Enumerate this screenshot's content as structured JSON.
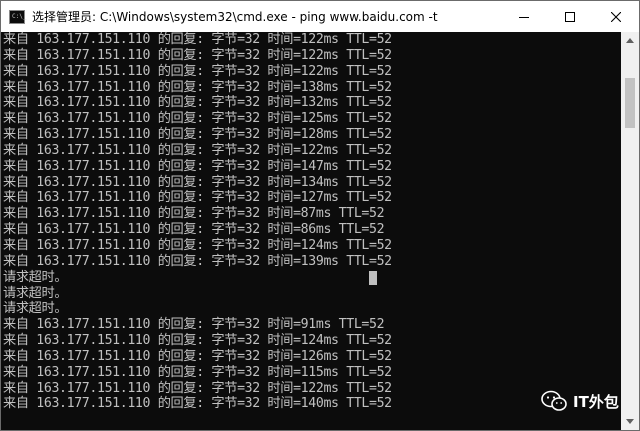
{
  "window": {
    "title": "选择管理员: C:\\Windows\\system32\\cmd.exe - ping  www.baidu.com -t",
    "icon": "cmd-icon",
    "icon_text": "C:\\_"
  },
  "controls": {
    "minimize": "minimize-icon",
    "maximize": "maximize-icon",
    "close": "close-icon"
  },
  "console": {
    "foreground": "#c0c0c0",
    "background": "#0c0c0c",
    "lines": [
      "来自 163.177.151.110 的回复: 字节=32 时间=122ms TTL=52",
      "来自 163.177.151.110 的回复: 字节=32 时间=122ms TTL=52",
      "来自 163.177.151.110 的回复: 字节=32 时间=122ms TTL=52",
      "来自 163.177.151.110 的回复: 字节=32 时间=138ms TTL=52",
      "来自 163.177.151.110 的回复: 字节=32 时间=132ms TTL=52",
      "来自 163.177.151.110 的回复: 字节=32 时间=125ms TTL=52",
      "来自 163.177.151.110 的回复: 字节=32 时间=128ms TTL=52",
      "来自 163.177.151.110 的回复: 字节=32 时间=122ms TTL=52",
      "来自 163.177.151.110 的回复: 字节=32 时间=147ms TTL=52",
      "来自 163.177.151.110 的回复: 字节=32 时间=134ms TTL=52",
      "来自 163.177.151.110 的回复: 字节=32 时间=127ms TTL=52",
      "来自 163.177.151.110 的回复: 字节=32 时间=87ms TTL=52",
      "来自 163.177.151.110 的回复: 字节=32 时间=86ms TTL=52",
      "来自 163.177.151.110 的回复: 字节=32 时间=124ms TTL=52",
      "来自 163.177.151.110 的回复: 字节=32 时间=139ms TTL=52",
      "请求超时。",
      "请求超时。",
      "请求超时。",
      "来自 163.177.151.110 的回复: 字节=32 时间=91ms TTL=52",
      "来自 163.177.151.110 的回复: 字节=32 时间=124ms TTL=52",
      "来自 163.177.151.110 的回复: 字节=32 时间=126ms TTL=52",
      "来自 163.177.151.110 的回复: 字节=32 时间=115ms TTL=52",
      "来自 163.177.151.110 的回复: 字节=32 时间=122ms TTL=52",
      "来自 163.177.151.110 的回复: 字节=32 时间=140ms TTL=52"
    ]
  },
  "scrollbar": {
    "up_icon": "scroll-up-icon",
    "down_icon": "scroll-down-icon"
  },
  "watermark": {
    "icon": "wechat-icon",
    "text": "IT外包"
  }
}
